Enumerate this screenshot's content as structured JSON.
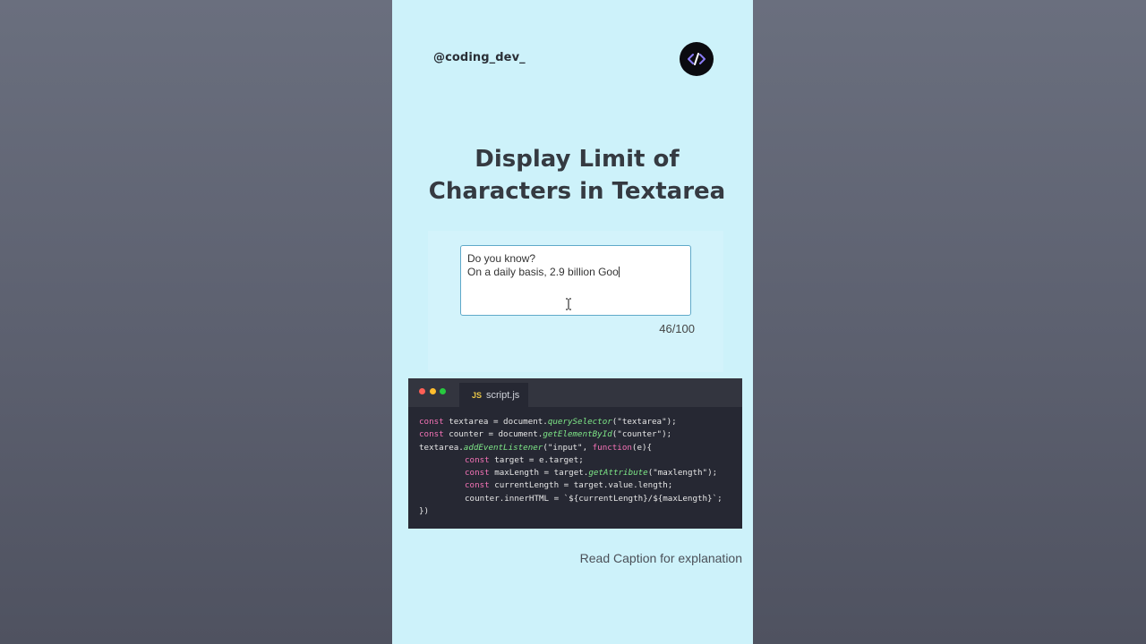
{
  "header": {
    "handle": "@coding_dev_",
    "logo_icon": "code-brackets-icon"
  },
  "title": {
    "line1": "Display Limit of",
    "line2": "Characters in Textarea"
  },
  "demo": {
    "textarea_line1": "Do you know?",
    "textarea_line2": "On a daily basis, 2.9 billion Goo",
    "counter": "46/100"
  },
  "editor": {
    "tab_badge": "JS",
    "tab_label": "script.js",
    "dot_colors": [
      "#ff5f56",
      "#ffbd2e",
      "#27c93f"
    ],
    "code": {
      "l1": {
        "kw": "const",
        "a": " textarea = document.",
        "fn": "querySelector",
        "b": "(\"textarea\");"
      },
      "l2": {
        "kw": "const",
        "a": " counter = document.",
        "fn": "getElementById",
        "b": "(\"counter\");"
      },
      "l3": {
        "a": "textarea.",
        "fn": "addEventListener",
        "b": "(\"input\", ",
        "kw": "function",
        "c": "(e){"
      },
      "l4": {
        "kw": "const",
        "a": " target = e.target;"
      },
      "l5": {
        "kw": "const",
        "a": " maxLength = target.",
        "fn": "getAttribute",
        "b": "(\"maxlength\");"
      },
      "l6": {
        "kw": "const",
        "a": " currentLength = target.value.length;"
      },
      "l7": {
        "a": "counter.innerHTML = `${currentLength}/${maxLength}`;"
      },
      "l8": {
        "a": "})"
      }
    }
  },
  "caption": "Read Caption for explanation"
}
